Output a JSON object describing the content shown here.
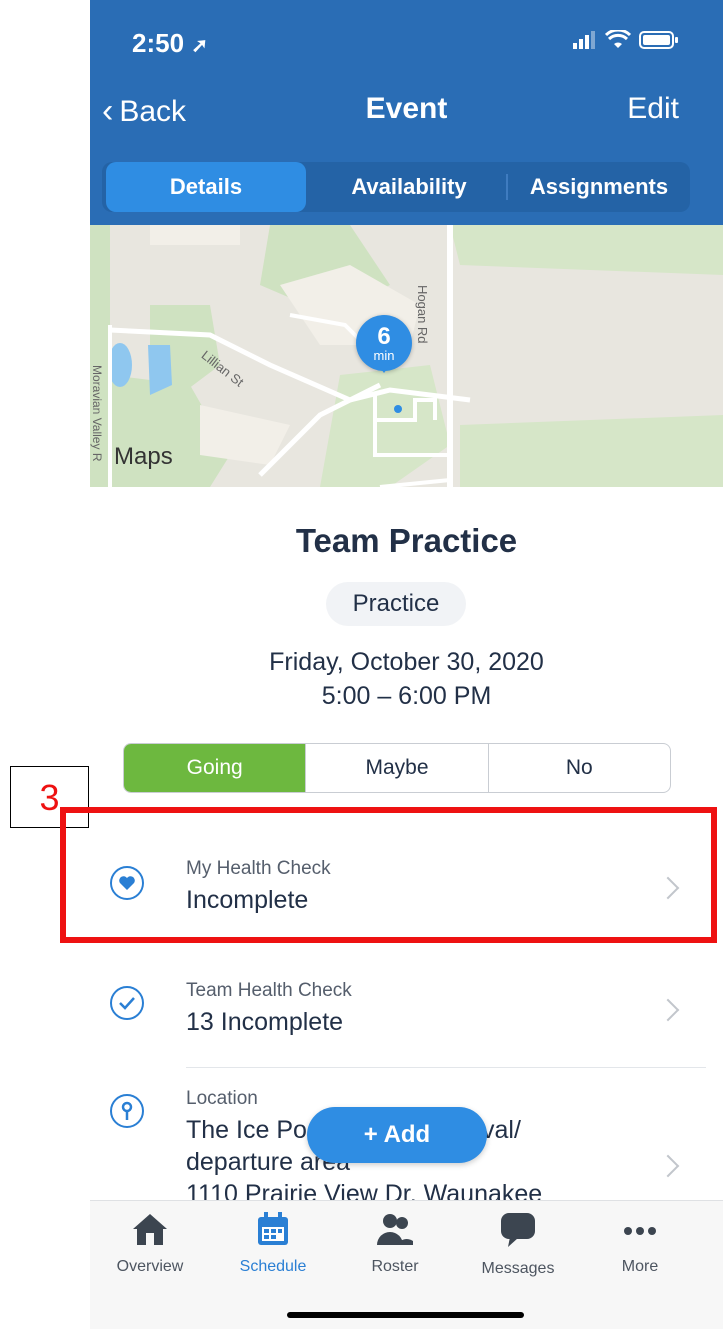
{
  "status_bar": {
    "time": "2:50"
  },
  "nav": {
    "back_label": "Back",
    "title": "Event",
    "edit_label": "Edit"
  },
  "tabs": {
    "details": "Details",
    "availability": "Availability",
    "assignments": "Assignments"
  },
  "map": {
    "pin_value": "6",
    "pin_unit": "min",
    "street_hogan": "Hogan Rd",
    "street_lillian": "Lillian St",
    "street_moravian": "Moravian Valley R",
    "attribution": "Maps"
  },
  "event": {
    "title": "Team Practice",
    "type_chip": "Practice",
    "date": "Friday, October 30, 2020",
    "time": "5:00 – 6:00 PM"
  },
  "rsvp": {
    "going": "Going",
    "maybe": "Maybe",
    "no": "No"
  },
  "rows": {
    "my_health": {
      "label": "My Health Check",
      "value": "Incomplete"
    },
    "team_health": {
      "label": "Team Health Check",
      "value": "13 Incomplete"
    },
    "location": {
      "label": "Location",
      "line1": "The Ice Po",
      "line1_tail": "val/",
      "line2": "departure area",
      "line3": "1110 Prairie View Dr, Waunakee"
    }
  },
  "add_button": {
    "label": "Add"
  },
  "tabbar": {
    "overview": "Overview",
    "schedule": "Schedule",
    "roster": "Roster",
    "messages": "Messages",
    "more": "More"
  },
  "annotation": {
    "label": "3",
    "color": "#ee1111"
  },
  "colors": {
    "header": "#2a6db5",
    "accent": "#2a7fd4",
    "going": "#6db83f"
  }
}
